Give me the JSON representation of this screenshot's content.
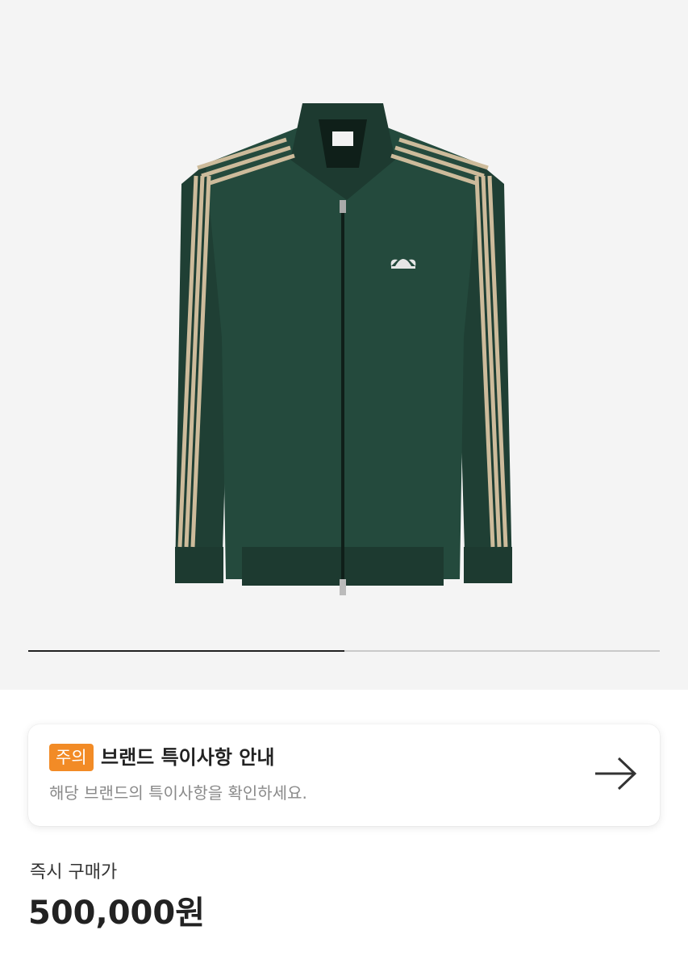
{
  "product": {
    "image_alt": "Green track jacket with beige three stripes",
    "colors": {
      "jacket": "#1f3f34",
      "stripe": "#cdbb9b",
      "accent": "#f28b26"
    },
    "gallery_progress": 0.5
  },
  "notice": {
    "badge": "주의",
    "title": "브랜드 특이사항 안내",
    "subtitle": "해당 브랜드의 특이사항을 확인하세요.",
    "icon": "arrow-right-icon"
  },
  "price": {
    "label": "즉시 구매가",
    "value": "500,000원"
  }
}
